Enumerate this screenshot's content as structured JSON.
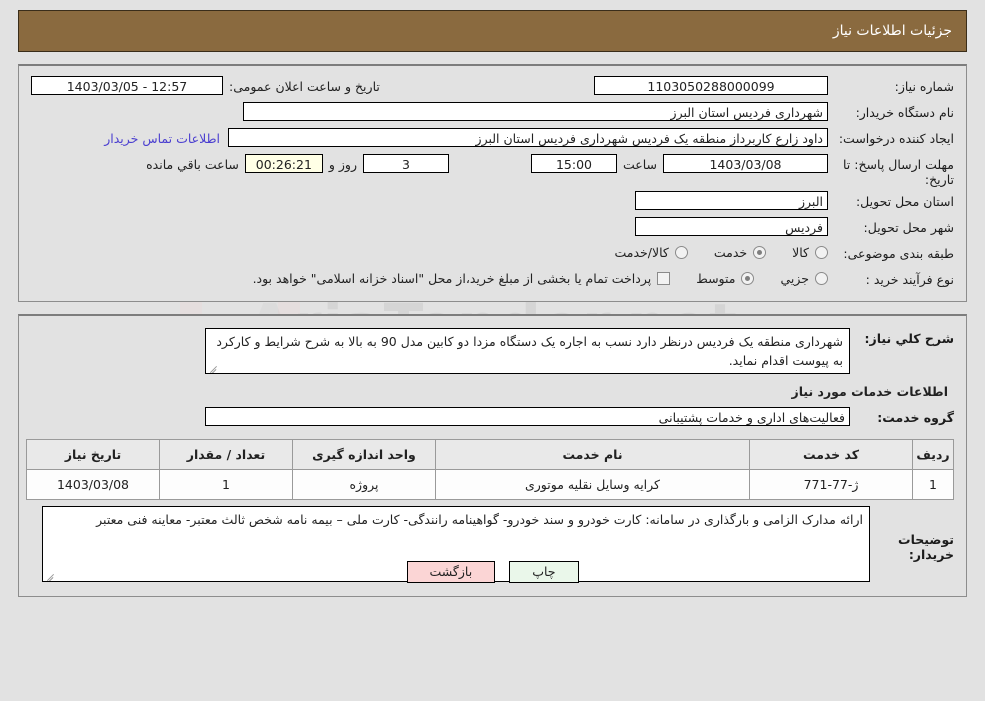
{
  "header": {
    "title": "جزئیات اطلاعات نیاز"
  },
  "watermark": {
    "text": "AriaTender.net"
  },
  "info": {
    "need_number_label": "شماره نیاز:",
    "need_number_value": "1103050288000099",
    "public_announce_label": "تاریخ و ساعت اعلان عمومی:",
    "public_announce_value": "12:57 - 1403/03/05",
    "buyer_org_label": "نام دستگاه خریدار:",
    "buyer_org_value": "شهرداری فردیس استان البرز",
    "creator_label": "ایجاد کننده درخواست:",
    "creator_value": "داود زارع کاربرداز منطقه یک فردیس شهرداری فردیس استان البرز",
    "contact_link": "اطلاعات تماس خریدار",
    "deadline_label": "مهلت ارسال پاسخ: تا تاریخ:",
    "deadline_date": "1403/03/08",
    "hour_label": "ساعت",
    "hour_value": "15:00",
    "days_value": "3",
    "days_label": "روز و",
    "timer_value": "00:26:21",
    "timer_label": "ساعت باقي مانده",
    "province_label": "استان محل تحویل:",
    "province_value": "البرز",
    "city_label": "شهر محل تحویل:",
    "city_value": "فردیس",
    "category_label": "طبقه بندی موضوعی:",
    "category_options": [
      {
        "label": "کالا",
        "selected": false
      },
      {
        "label": "خدمت",
        "selected": true
      },
      {
        "label": "کالا/خدمت",
        "selected": false
      }
    ],
    "process_label": "نوع فرآیند خرید :",
    "process_options": [
      {
        "label": "جزیي",
        "selected": false
      },
      {
        "label": "متوسط",
        "selected": true
      }
    ],
    "treasury_checkbox_label": "پرداخت تمام یا بخشی از مبلغ خرید،از محل \"اسناد خزانه اسلامی\" خواهد بود.",
    "treasury_checked": false
  },
  "details": {
    "summary_label": "شرح کلي نیاز:",
    "summary_value": "شهرداری منطقه یک فردیس درنظر دارد نسب  به اجاره یک دستگاه مزدا دو کابین مدل 90 به بالا به شرح شرایط و کارکرد به پیوست اقدام نماید.",
    "services_section_title": "اطلاعات خدمات مورد نیاز",
    "service_group_label": "گروه خدمت:",
    "service_group_value": "فعالیت‌های اداری و خدمات پشتیبانی",
    "table": {
      "headers": [
        "ردیف",
        "کد خدمت",
        "نام خدمت",
        "واحد اندازه گیری",
        "تعداد / مقدار",
        "تاریخ نیاز"
      ],
      "rows": [
        {
          "radif": "1",
          "code": "ژ-77-771",
          "name": "کرایه وسایل نقلیه موتوری",
          "unit": "پروژه",
          "qty": "1",
          "date": "1403/03/08"
        }
      ]
    },
    "buyer_notes_label": "توضیحات خریدار:",
    "buyer_notes_value": "ارائه مدارک الزامی و بارگذاری در سامانه: کارت خودرو و سند خودرو- گواهینامه رانندگی- کارت ملی – بیمه نامه شخص ثالث معتبر- معاینه فنی معتبر"
  },
  "footer": {
    "print_label": "چاپ",
    "back_label": "بازگشت"
  },
  "colors": {
    "header_bg": "#8a6a3f",
    "page_bg": "#e2e2e2",
    "link": "#4b3fd0",
    "print_btn": "#eaf7ea",
    "back_btn": "#fbd5d5",
    "timer_bg": "#ffffe6"
  }
}
